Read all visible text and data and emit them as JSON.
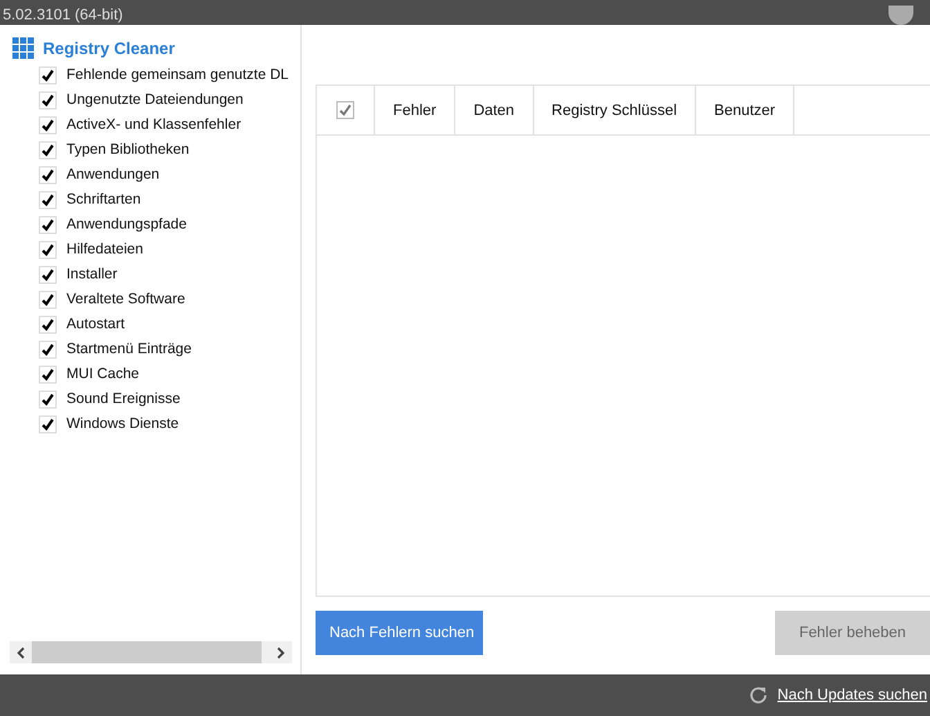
{
  "title_bar": {
    "version": "5.02.3101 (64-bit)"
  },
  "sidebar": {
    "title": "Registry Cleaner",
    "items": [
      {
        "label": "Fehlende gemeinsam genutzte DL",
        "checked": true
      },
      {
        "label": "Ungenutzte Dateiendungen",
        "checked": true
      },
      {
        "label": "ActiveX- und Klassenfehler",
        "checked": true
      },
      {
        "label": "Typen Bibliotheken",
        "checked": true
      },
      {
        "label": "Anwendungen",
        "checked": true
      },
      {
        "label": "Schriftarten",
        "checked": true
      },
      {
        "label": "Anwendungspfade",
        "checked": true
      },
      {
        "label": "Hilfedateien",
        "checked": true
      },
      {
        "label": "Installer",
        "checked": true
      },
      {
        "label": "Veraltete Software",
        "checked": true
      },
      {
        "label": "Autostart",
        "checked": true
      },
      {
        "label": "Startmenü Einträge",
        "checked": true
      },
      {
        "label": "MUI Cache",
        "checked": true
      },
      {
        "label": "Sound Ereignisse",
        "checked": true
      },
      {
        "label": "Windows Dienste",
        "checked": true
      }
    ]
  },
  "table": {
    "select_all_checked": true,
    "columns": [
      "Fehler",
      "Daten",
      "Registry Schlüssel",
      "Benutzer"
    ]
  },
  "buttons": [
    {
      "label": "Nach Fehlern suchen",
      "disabled": false
    },
    {
      "label": "Fehler beheben",
      "disabled": true
    }
  ],
  "status_bar": {
    "link": "Nach Updates suchen"
  }
}
